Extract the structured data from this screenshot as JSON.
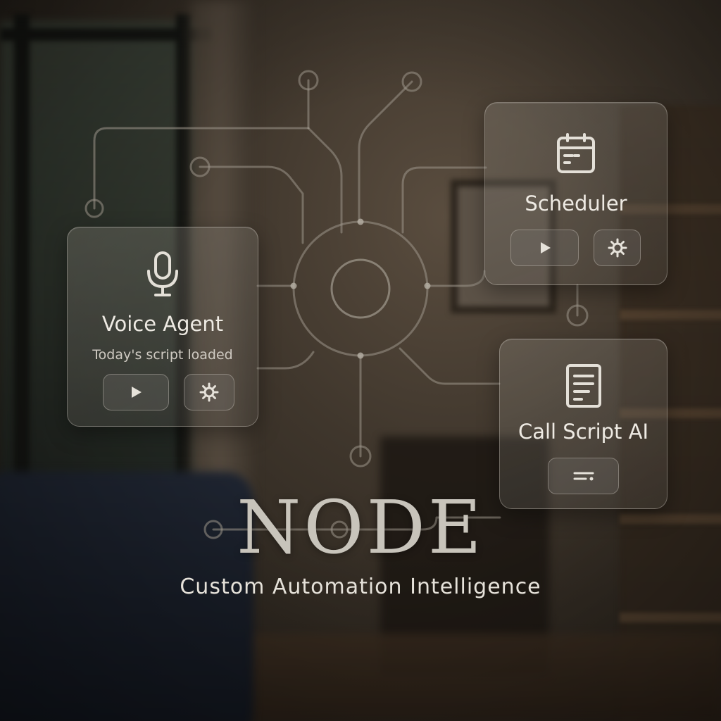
{
  "brand": {
    "name": "NODE",
    "tagline": "Custom Automation Intelligence"
  },
  "cards": {
    "voice_agent": {
      "title": "Voice Agent",
      "subtitle": "Today's script loaded",
      "icon": "microphone-icon",
      "buttons": [
        "play-icon",
        "gear-icon"
      ]
    },
    "scheduler": {
      "title": "Scheduler",
      "icon": "calendar-icon",
      "buttons": [
        "play-icon",
        "gear-icon"
      ]
    },
    "call_script_ai": {
      "title": "Call Script AI",
      "icon": "document-icon",
      "buttons": [
        "text-lines-icon"
      ]
    }
  },
  "colors": {
    "text": "#eeeae3",
    "brand_text": "#c8c4bb",
    "circuit_line": "#9c958a"
  }
}
